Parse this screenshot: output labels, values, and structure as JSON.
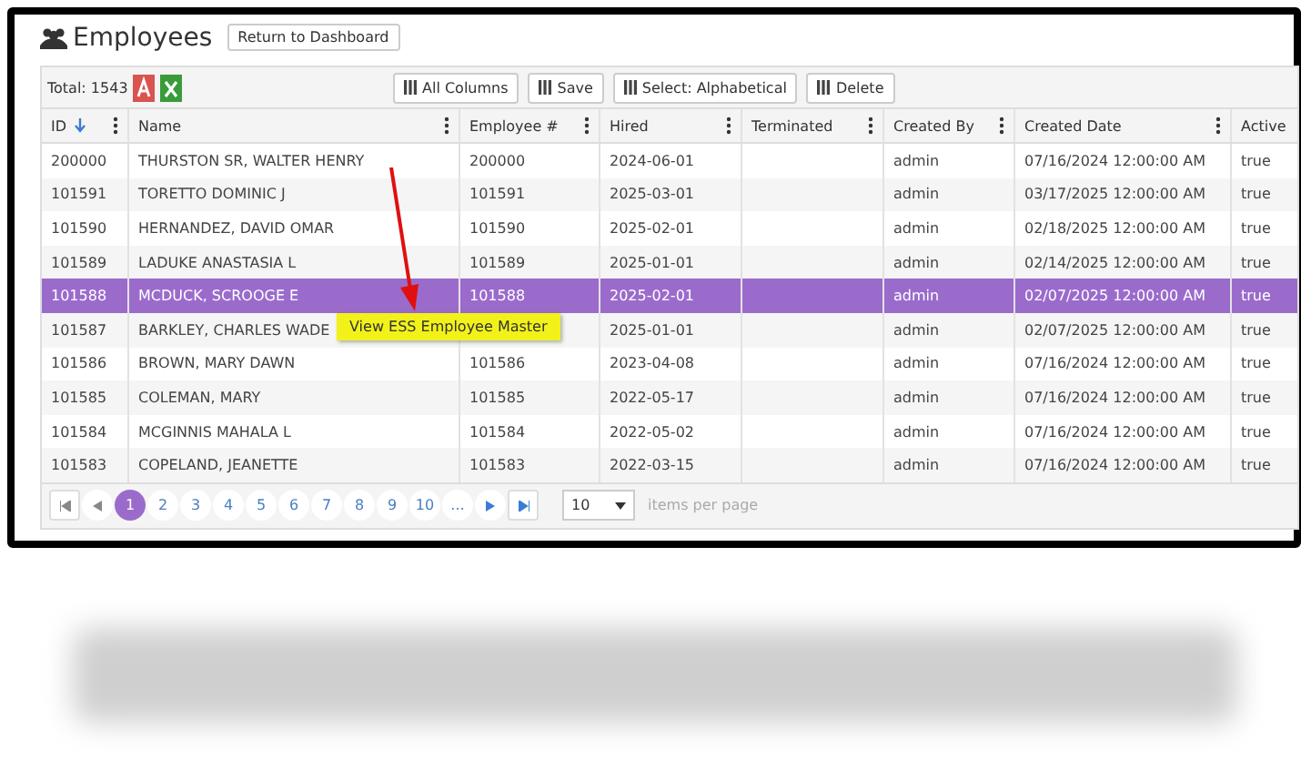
{
  "header": {
    "title": "Employees",
    "back_button": "Return to Dashboard"
  },
  "toolbar": {
    "total": "Total: 1543",
    "buttons": [
      "All Columns",
      "Save",
      "Select: Alphabetical",
      "Delete"
    ]
  },
  "table": {
    "columns": [
      {
        "label": "ID",
        "sorted": true
      },
      {
        "label": "Name",
        "sorted": false
      },
      {
        "label": "Employee #",
        "sorted": false
      },
      {
        "label": "Hired",
        "sorted": false
      },
      {
        "label": "Terminated",
        "sorted": false
      },
      {
        "label": "Created By",
        "sorted": false
      },
      {
        "label": "Created Date",
        "sorted": false
      },
      {
        "label": "Active",
        "sorted": false
      }
    ],
    "rows": [
      {
        "id": "200000",
        "name": "THURSTON SR, WALTER HENRY",
        "employee_no": "200000",
        "hired": "2024-06-01",
        "created_by": "admin",
        "created_date": "07/16/2024 12:00:00 AM",
        "active": "true",
        "selected": false
      },
      {
        "id": "101591",
        "name": "TORETTO DOMINIC J",
        "employee_no": "101591",
        "hired": "2025-03-01",
        "created_by": "admin",
        "created_date": "03/17/2025 12:00:00 AM",
        "active": "true",
        "selected": false
      },
      {
        "id": "101590",
        "name": "HERNANDEZ, DAVID OMAR",
        "employee_no": "101590",
        "hired": "2025-02-01",
        "created_by": "admin",
        "created_date": "02/18/2025 12:00:00 AM",
        "active": "true",
        "selected": false
      },
      {
        "id": "101589",
        "name": "LADUKE ANASTASIA L",
        "employee_no": "101589",
        "hired": "2025-01-01",
        "created_by": "admin",
        "created_date": "02/14/2025 12:00:00 AM",
        "active": "true",
        "selected": false
      },
      {
        "id": "101588",
        "name": "MCDUCK, SCROOGE E",
        "employee_no": "101588",
        "hired": "2025-02-01",
        "created_by": "admin",
        "created_date": "02/07/2025 12:00:00 AM",
        "active": "true",
        "selected": true
      },
      {
        "id": "101587",
        "name": "BARKLEY, CHARLES WADE",
        "hired": "2025-01-01",
        "created_by": "admin",
        "created_date": "02/07/2025 12:00:00 AM",
        "active": "true",
        "selected": false
      },
      {
        "id": "101586",
        "name": "BROWN, MARY DAWN",
        "employee_no": "101586",
        "hired": "2023-04-08",
        "created_by": "admin",
        "created_date": "07/16/2024 12:00:00 AM",
        "active": "true",
        "selected": false
      },
      {
        "id": "101585",
        "name": "COLEMAN, MARY",
        "employee_no": "101585",
        "hired": "2022-05-17",
        "created_by": "admin",
        "created_date": "07/16/2024 12:00:00 AM",
        "active": "true",
        "selected": false
      },
      {
        "id": "101584",
        "name": "MCGINNIS MAHALA L",
        "employee_no": "101584",
        "hired": "2022-05-02",
        "created_by": "admin",
        "created_date": "07/16/2024 12:00:00 AM",
        "active": "true",
        "selected": false
      },
      {
        "id": "101583",
        "name": "COPELAND, JEANETTE",
        "employee_no": "101583",
        "hired": "2022-03-15",
        "created_by": "admin",
        "created_date": "07/16/2024 12:00:00 AM",
        "active": "true",
        "selected": false
      }
    ]
  },
  "tooltip": "View ESS Employee Master",
  "pager": {
    "pages": [
      {
        "label": "1",
        "selected": true
      },
      {
        "label": "2",
        "selected": false
      },
      {
        "label": "3",
        "selected": false
      },
      {
        "label": "4",
        "selected": false
      },
      {
        "label": "5",
        "selected": false
      },
      {
        "label": "6",
        "selected": false
      },
      {
        "label": "7",
        "selected": false
      },
      {
        "label": "8",
        "selected": false
      },
      {
        "label": "9",
        "selected": false
      },
      {
        "label": "10",
        "selected": false
      },
      {
        "label": "...",
        "selected": false
      }
    ],
    "page_size": "10",
    "page_size_label": "items per page"
  }
}
